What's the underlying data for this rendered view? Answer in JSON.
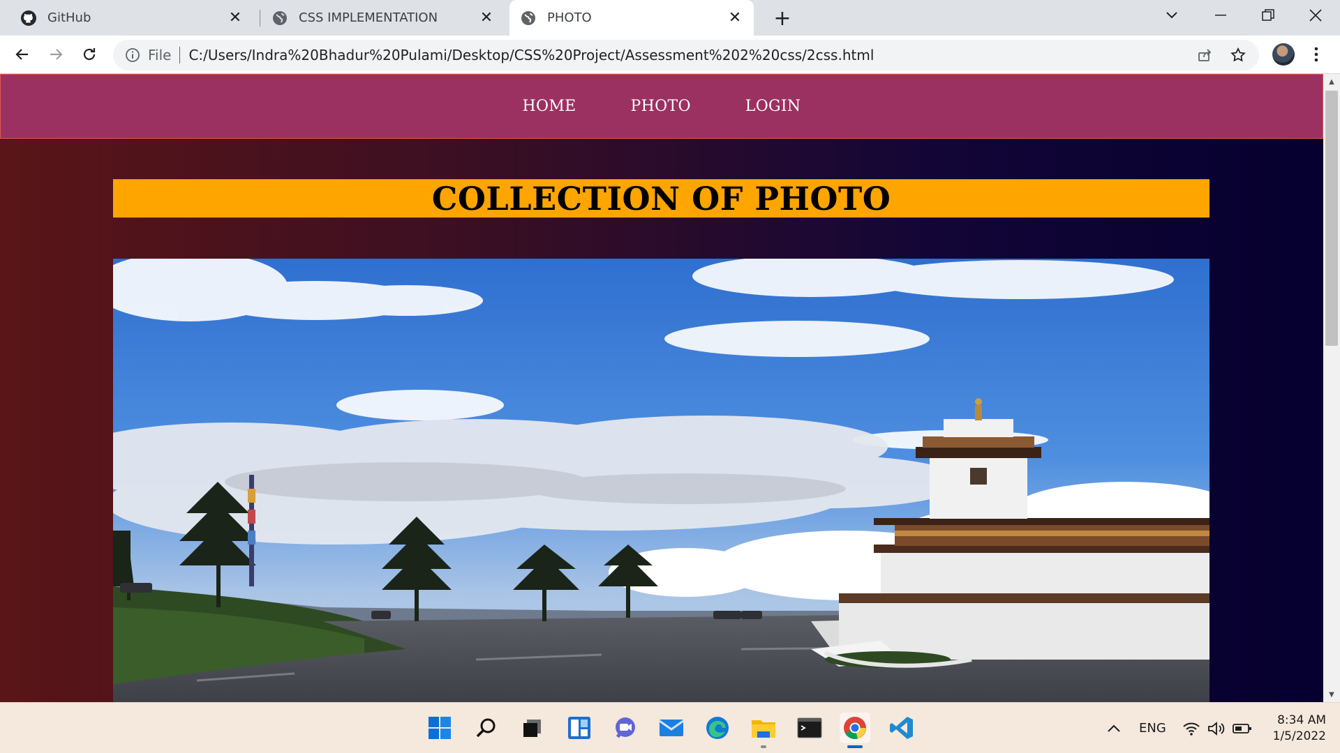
{
  "browser": {
    "tabs": [
      {
        "title": "GitHub",
        "icon": "github-icon"
      },
      {
        "title": "CSS IMPLEMENTATION",
        "icon": "globe-icon"
      },
      {
        "title": "PHOTO",
        "icon": "globe-icon",
        "active": true
      }
    ],
    "address": {
      "scheme_label": "File",
      "url": "C:/Users/Indra%20Bhadur%20Pulami/Desktop/CSS%20Project/Assessment%202%20css/2css.html"
    }
  },
  "page": {
    "nav": [
      "HOME",
      "PHOTO",
      "LOGIN"
    ],
    "heading": "COLLECTION OF PHOTO",
    "colors": {
      "nav_bg": "#9b3161",
      "heading_bg": "#ffa500",
      "gradient_left": "#5a1517",
      "gradient_right": "#05002f"
    },
    "photo": {
      "subject": "landscape-photo-stupa-sky-trees-road"
    }
  },
  "taskbar": {
    "apps": [
      "windows-start-icon",
      "search-icon",
      "task-view-icon",
      "widgets-icon",
      "chat-icon",
      "mail-icon",
      "edge-icon",
      "file-explorer-icon",
      "terminal-icon",
      "chrome-icon",
      "vscode-icon"
    ],
    "tray": {
      "language": "ENG"
    },
    "clock": {
      "time": "8:34 AM",
      "date": "1/5/2022"
    }
  }
}
